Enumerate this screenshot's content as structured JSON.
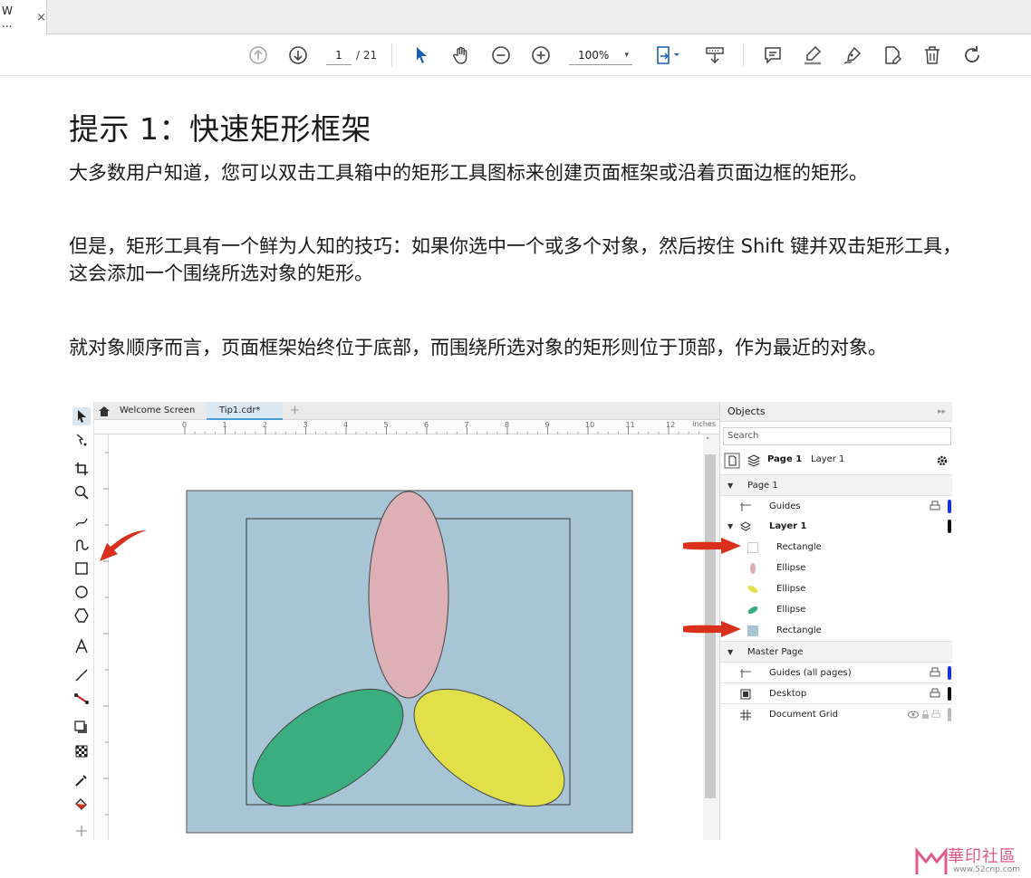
{
  "tab": {
    "title": "W ...",
    "close": "×"
  },
  "toolbar": {
    "page_current": "1",
    "page_total": "/ 21",
    "zoom": "100%",
    "zoom_arrow": "▾",
    "icons": [
      "arrow-up-circle-icon",
      "arrow-down-circle-icon",
      "select-pointer-icon",
      "hand-pan-icon",
      "zoom-out-icon",
      "zoom-in-icon",
      "fit-page-icon",
      "scroll-mode-icon",
      "comment-icon",
      "highlight-pen-icon",
      "sign-icon",
      "fill-sign-icon",
      "delete-icon",
      "rotate-icon"
    ],
    "accent": "#1a5fb4"
  },
  "document": {
    "title": "提示 1：快速矩形框架",
    "paragraphs": [
      "大多数用户知道，您可以双击工具箱中的矩形工具图标来创建页面框架或沿着页面边框的矩形。",
      "但是，矩形工具有一个鲜为人知的技巧：如果你选中一个或多个对象，然后按住 Shift 键并双击矩形工具，这会添加一个围绕所选对象的矩形。",
      "就对象顺序而言，页面框架始终位于底部，而围绕所选对象的矩形则位于顶部，作为最近的对象。"
    ]
  },
  "app": {
    "tabs": [
      "Welcome Screen",
      "Tip1.cdr*",
      "+"
    ],
    "ruler_units": "inches",
    "ruler_ticks": [
      "0",
      "1",
      "2",
      "3",
      "4",
      "5",
      "6",
      "7",
      "8",
      "9",
      "10",
      "11",
      "12"
    ],
    "canvas_colors": {
      "page_frame": "#a8c5d6",
      "ellipse_pink": "#ddb0b6",
      "ellipse_green": "#3aae7e",
      "ellipse_yellow": "#e1e04a"
    },
    "objects_panel": {
      "title": "Objects",
      "search_placeholder": "Search",
      "page_label": "Page 1",
      "layer_label": "Layer 1",
      "rows": [
        {
          "label": "Page 1",
          "type": "page"
        },
        {
          "label": "Guides",
          "type": "guides",
          "color": "#1a2fe0"
        },
        {
          "label": "Layer 1",
          "type": "layer",
          "color": "#111111"
        },
        {
          "label": "Rectangle",
          "type": "rect-empty"
        },
        {
          "label": "Ellipse",
          "type": "ellipse",
          "color": "#ddb0b6"
        },
        {
          "label": "Ellipse",
          "type": "ellipse",
          "color": "#e1e04a"
        },
        {
          "label": "Ellipse",
          "type": "ellipse",
          "color": "#3aae7e"
        },
        {
          "label": "Rectangle",
          "type": "rect-filled",
          "color": "#a8c5d6"
        },
        {
          "label": "Master Page",
          "type": "page"
        },
        {
          "label": "Guides (all pages)",
          "type": "guides",
          "color": "#1a2fe0"
        },
        {
          "label": "Desktop",
          "type": "desktop",
          "color": "#111111"
        },
        {
          "label": "Document Grid",
          "type": "grid",
          "color": "#bbbbbb"
        }
      ]
    },
    "highlight_color": "#d9301c"
  },
  "watermark": {
    "text": "華印社區",
    "url": "www.52cnp.com"
  }
}
